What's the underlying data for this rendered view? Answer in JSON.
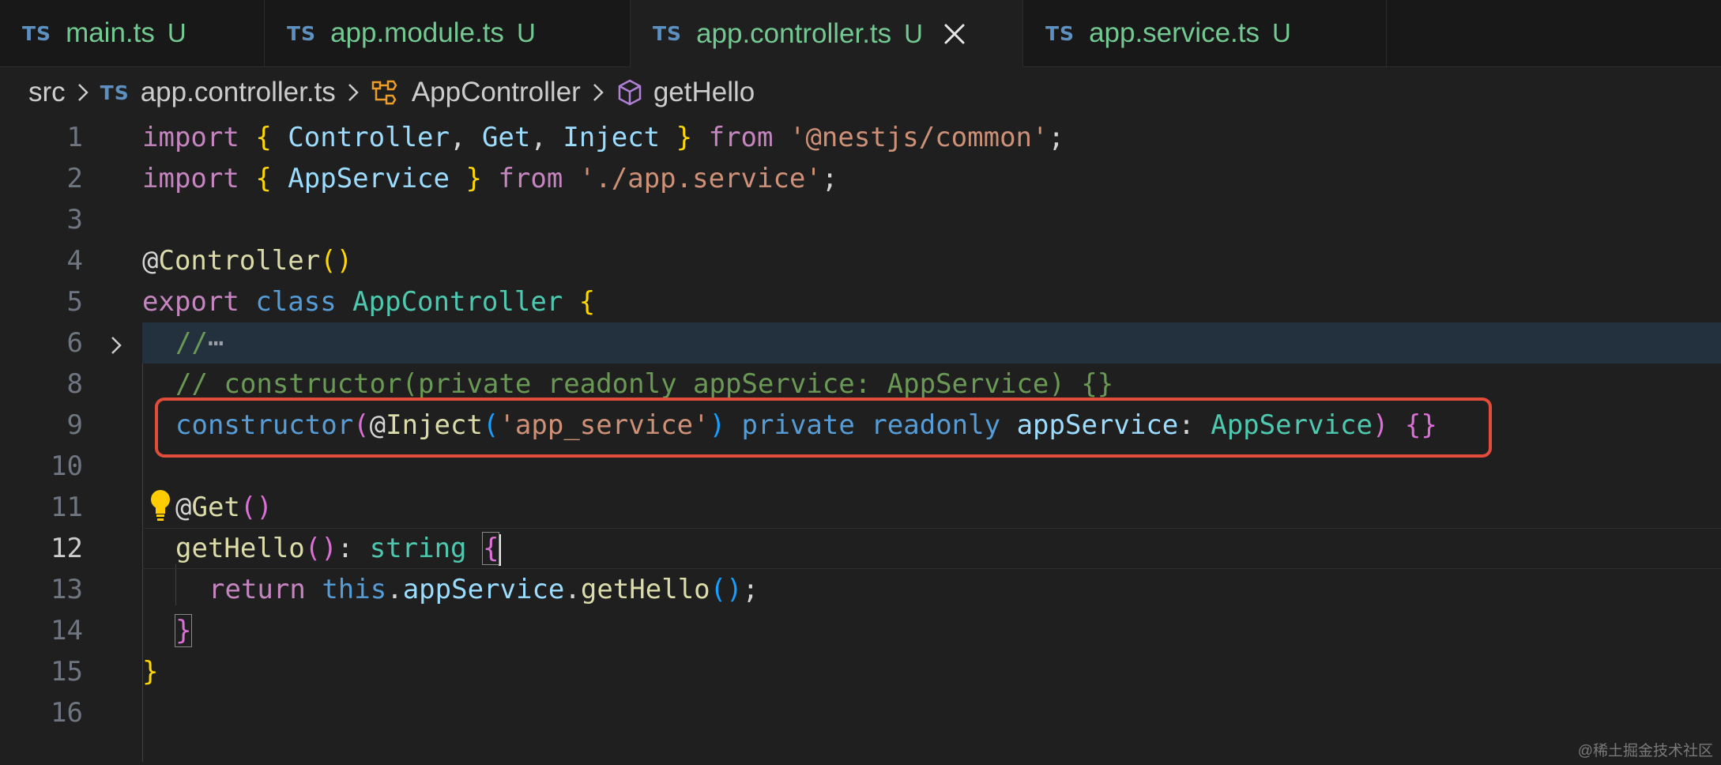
{
  "tabs": [
    {
      "badge": "TS",
      "name": "main.ts",
      "status": "U"
    },
    {
      "badge": "TS",
      "name": "app.module.ts",
      "status": "U"
    },
    {
      "badge": "TS",
      "name": "app.controller.ts",
      "status": "U"
    },
    {
      "badge": "TS",
      "name": "app.service.ts",
      "status": "U"
    }
  ],
  "active_tab": "app.controller.ts",
  "breadcrumb": {
    "folder": "src",
    "file_badge": "TS",
    "file": "app.controller.ts",
    "class": "AppController",
    "method": "getHello"
  },
  "editor": {
    "current_line": 12,
    "line_numbers": [
      "1",
      "2",
      "3",
      "4",
      "5",
      "6",
      "8",
      "9",
      "10",
      "11",
      "12",
      "13",
      "14",
      "15",
      "16"
    ],
    "tokens": {
      "l1": [
        "import",
        " ",
        "{",
        " ",
        "Controller",
        ", ",
        "Get",
        ", ",
        "Inject",
        " ",
        "}",
        " ",
        "from",
        " ",
        "'@nestjs/common'",
        ";"
      ],
      "l2": [
        "import",
        " ",
        "{",
        " ",
        "AppService",
        " ",
        "}",
        " ",
        "from",
        " ",
        "'./app.service'",
        ";"
      ],
      "l4": [
        "@",
        "Controller",
        "(",
        ")"
      ],
      "l5": [
        "export",
        " ",
        "class",
        " ",
        "AppController",
        " ",
        "{"
      ],
      "l6": [
        "//",
        "⋯"
      ],
      "l8": [
        "// constructor(private readonly appService: AppService) {}"
      ],
      "l9": [
        "constructor",
        "(",
        "@",
        "Inject",
        "(",
        "'app_service'",
        ")",
        " ",
        "private",
        " ",
        "readonly",
        " ",
        "appService",
        ": ",
        "AppService",
        ")",
        " ",
        "{}"
      ],
      "l11": [
        "@",
        "Get",
        "(",
        ")"
      ],
      "l12": [
        "getHello",
        "(",
        ")",
        ": ",
        "string",
        " ",
        "{"
      ],
      "l13": [
        "return",
        " ",
        "this",
        ".",
        "appService",
        ".",
        "getHello",
        "(",
        ")",
        ";"
      ],
      "l14": [
        "}"
      ],
      "l15": [
        "}"
      ]
    }
  },
  "watermark": "@稀土掘金技术社区",
  "colors": {
    "editor_bg": "#1f1f1f",
    "tab_modified": "#73c991",
    "highlight_box": "#e34b3a",
    "keyword": "#c586c0",
    "storage": "#569cd6",
    "type": "#4ec9b0",
    "string": "#ce9178",
    "function": "#dcdcaa",
    "comment": "#6a9955"
  }
}
